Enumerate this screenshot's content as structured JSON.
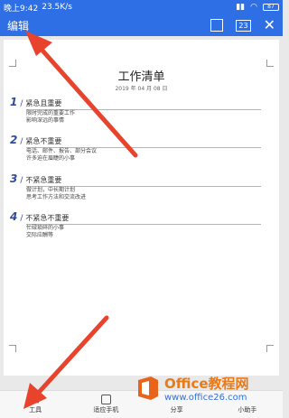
{
  "statusbar": {
    "time": "晚上9:42",
    "speed": "23.5K/s",
    "battery": "87"
  },
  "topbar": {
    "edit_label": "编辑",
    "page_count": "23"
  },
  "document": {
    "title": "工作清单",
    "date": "2019 年 04 月 08 日",
    "sections": [
      {
        "num": "1",
        "title": "紧急且重要",
        "lines": [
          "限时完成的重要工作",
          "影响深远的事情"
        ]
      },
      {
        "num": "2",
        "title": "紧急不重要",
        "lines": [
          "电话、邮件、报告、部分会议",
          "许多迫在眉睫的小事"
        ]
      },
      {
        "num": "3",
        "title": "不紧急重要",
        "lines": [
          "做计划，中长期计划",
          "思考工作方法和交流改进"
        ]
      },
      {
        "num": "4",
        "title": "不紧急不重要",
        "lines": [
          "忙碌琐碎的小事",
          "交际应酬等"
        ]
      }
    ]
  },
  "bottombar": {
    "tools": "工具",
    "mobile": "适应手机",
    "share": "分享",
    "assistant": "小助手"
  },
  "watermark": {
    "logo_text": "Office教程网",
    "url": "www.office26.com"
  },
  "colors": {
    "accent": "#2f6fe6",
    "arrow": "#e8432d"
  }
}
